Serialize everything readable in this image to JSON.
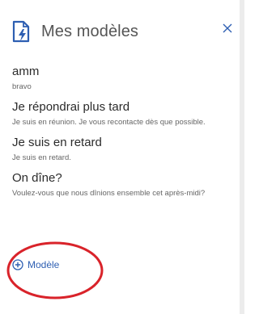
{
  "header": {
    "title": "Mes modèles",
    "icon": "template-lightning-icon",
    "close_icon": "close-icon"
  },
  "templates": [
    {
      "title": "amm",
      "body": "bravo"
    },
    {
      "title": "Je répondrai plus tard",
      "body": "Je suis en réunion. Je vous recontacte dès que possible."
    },
    {
      "title": "Je suis en retard",
      "body": "Je suis en retard."
    },
    {
      "title": "On dîne?",
      "body": "Voulez-vous que nous dînions ensemble cet après-midi?"
    }
  ],
  "add_button": {
    "label": "Modèle",
    "icon": "plus-circle-icon"
  },
  "colors": {
    "accent": "#2e5fb2",
    "annotation": "#d9232a",
    "text": "#2b2b2b",
    "muted": "#666666"
  }
}
